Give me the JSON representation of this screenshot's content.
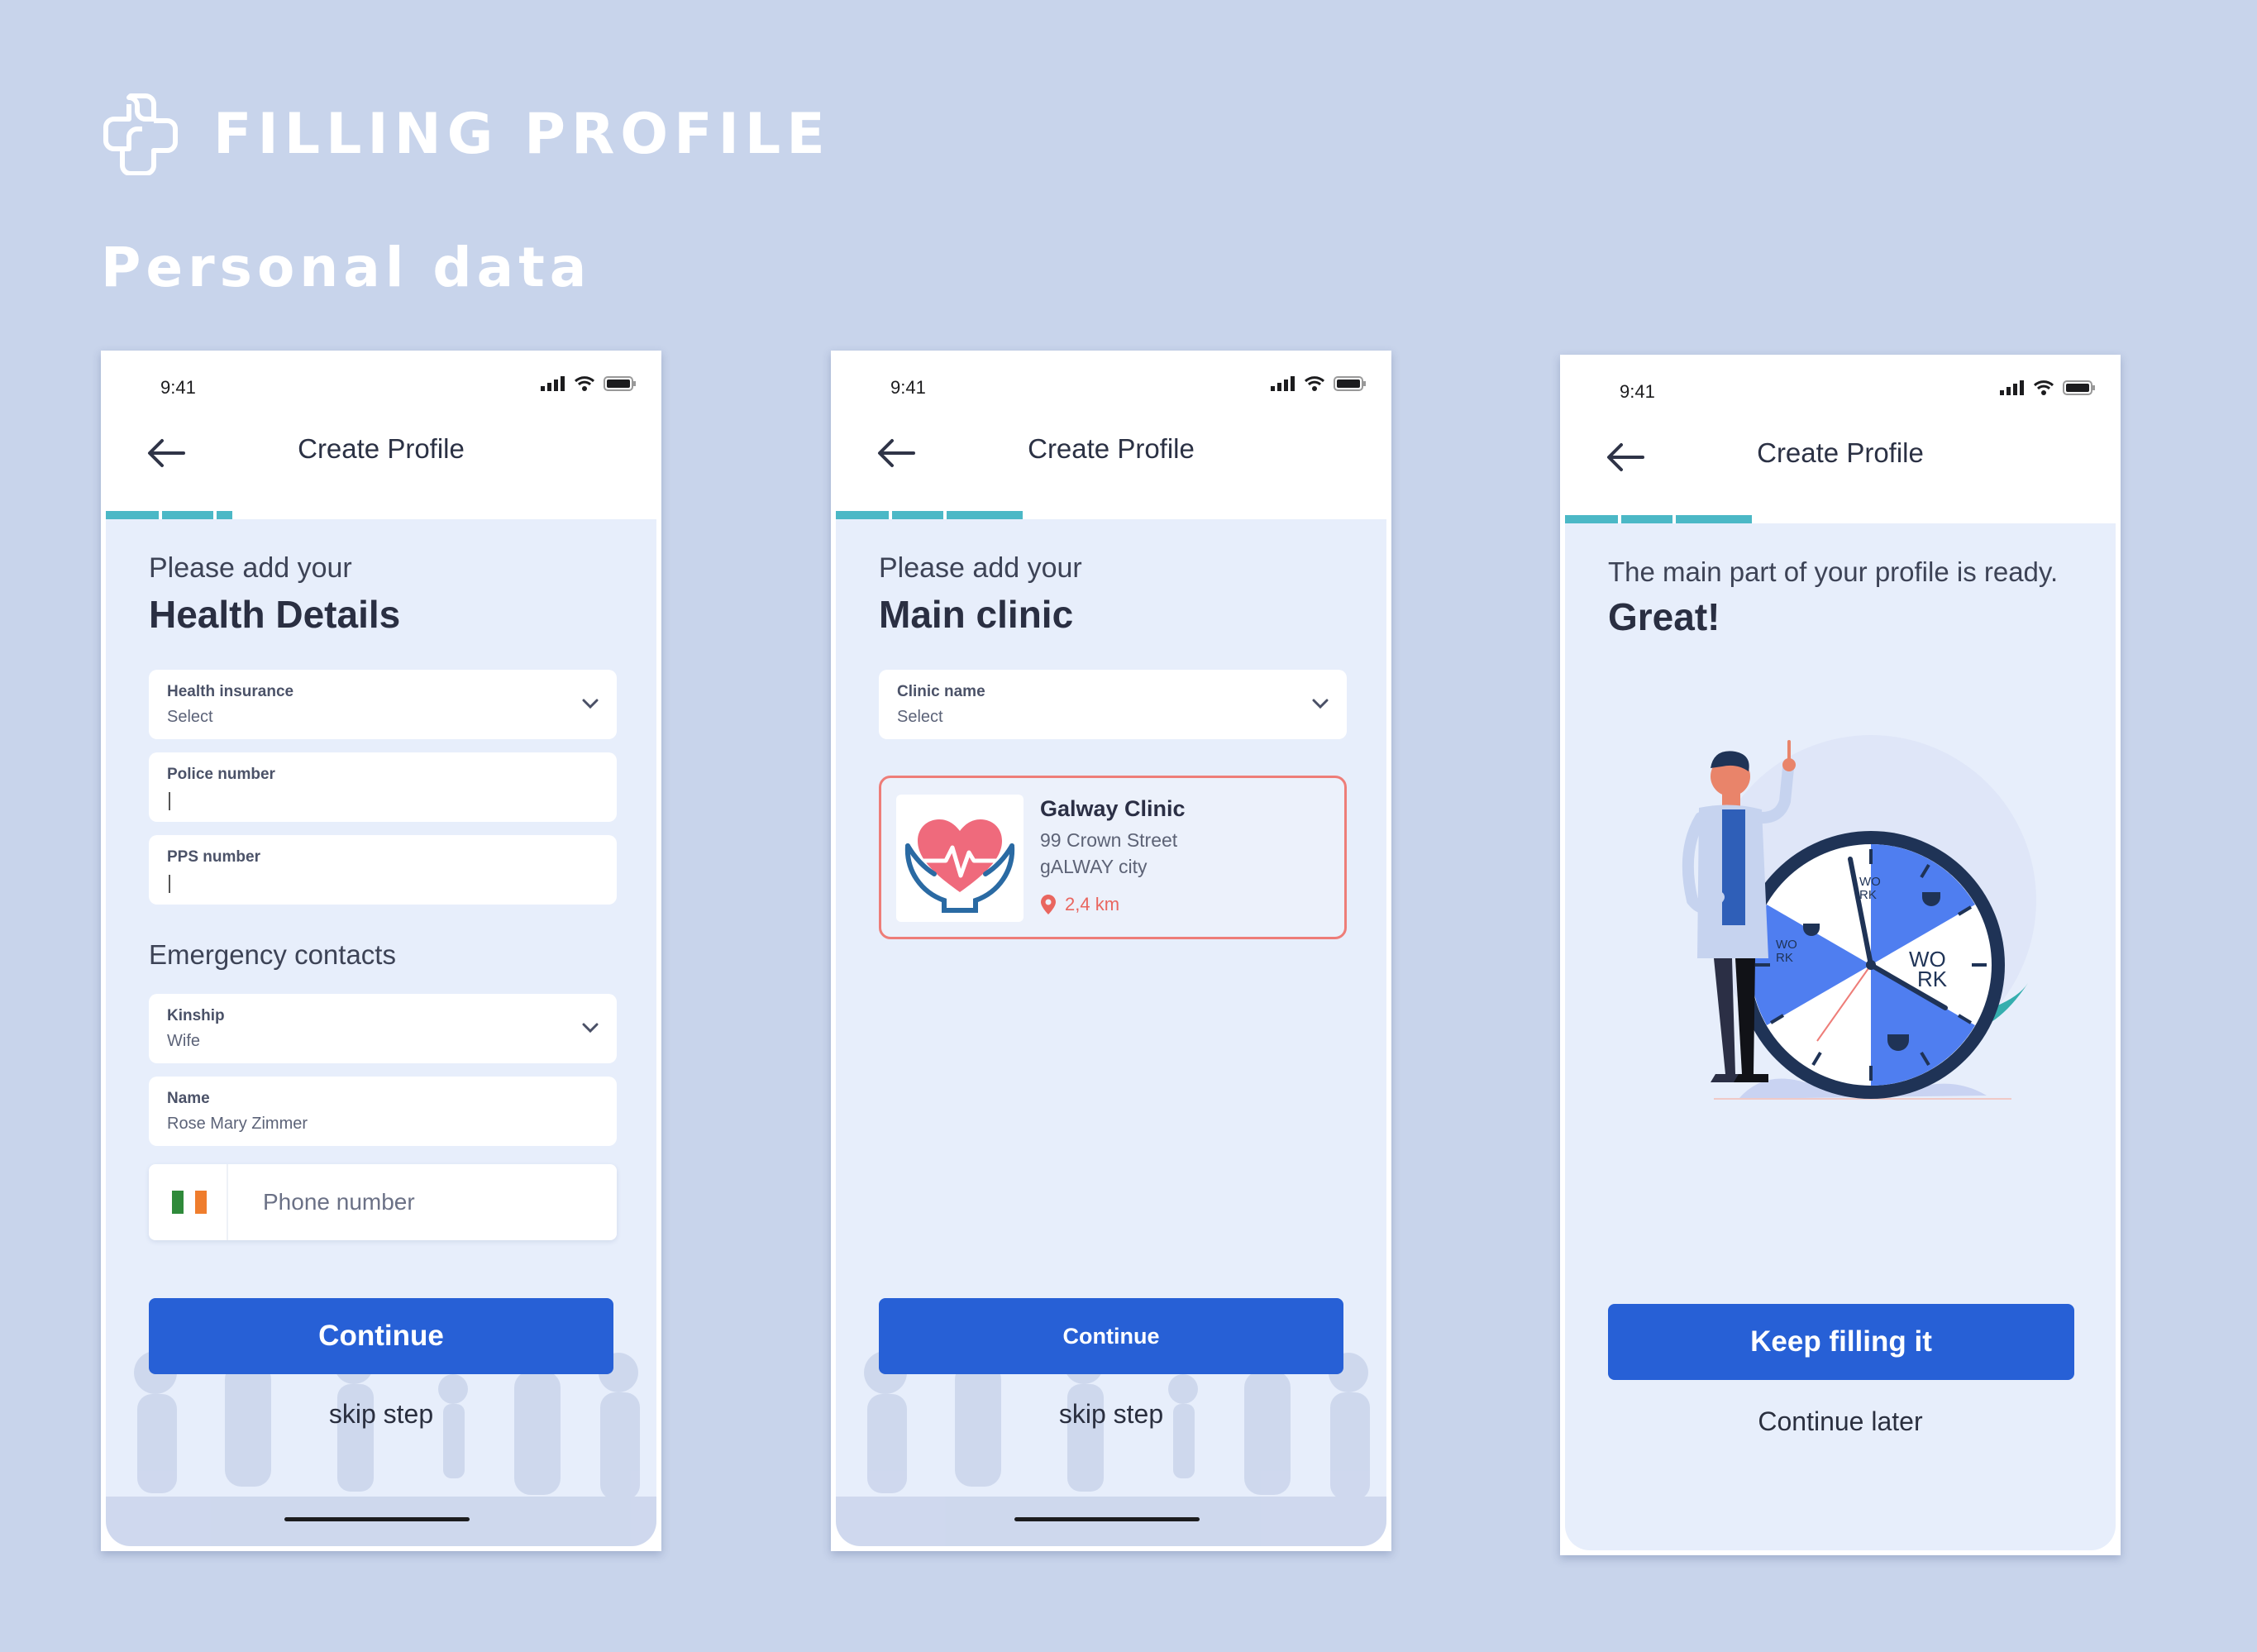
{
  "page": {
    "title": "FILLING PROFILE",
    "section": "Personal data"
  },
  "colors": {
    "background": "#c8d4eb",
    "primary_button": "#2760d6",
    "progress": "#4bb8c6",
    "card_border": "#ee7d78"
  },
  "screens": [
    {
      "status_time": "9:41",
      "header_title": "Create Profile",
      "progress": 0.23,
      "lead": "Please add your",
      "headline": "Health Details",
      "fields": [
        {
          "label": "Health insurance",
          "value": "Select"
        },
        {
          "label": "Police number",
          "value": ""
        },
        {
          "label": "PPS number",
          "value": ""
        }
      ],
      "emergency_title": "Emergency contacts",
      "emergency_fields": [
        {
          "label": "Kinship",
          "value": "Wife"
        },
        {
          "label": "Name",
          "value": "Rose Mary Zimmer"
        }
      ],
      "phone_placeholder": "Phone number",
      "primary_button": "Continue",
      "secondary_link": "skip step"
    },
    {
      "status_time": "9:41",
      "header_title": "Create Profile",
      "progress": 0.34,
      "lead": "Please add your",
      "headline": "Main clinic",
      "clinic_field": {
        "label": "Clinic name",
        "value": "Select"
      },
      "clinic": {
        "name": "Galway Clinic",
        "address": "99 Crown Street",
        "city": "gALWAY city",
        "distance": "2,4 km"
      },
      "primary_button": "Continue",
      "secondary_link": "skip step"
    },
    {
      "status_time": "9:41",
      "header_title": "Create Profile",
      "progress": 0.34,
      "lead": "The main part of your profile is ready.",
      "headline": "Great!",
      "clock_labels": [
        "WO",
        "RK",
        "WO",
        "RK",
        "WO",
        "RK"
      ],
      "primary_button": "Keep filling it",
      "secondary_link": "Continue later"
    }
  ]
}
